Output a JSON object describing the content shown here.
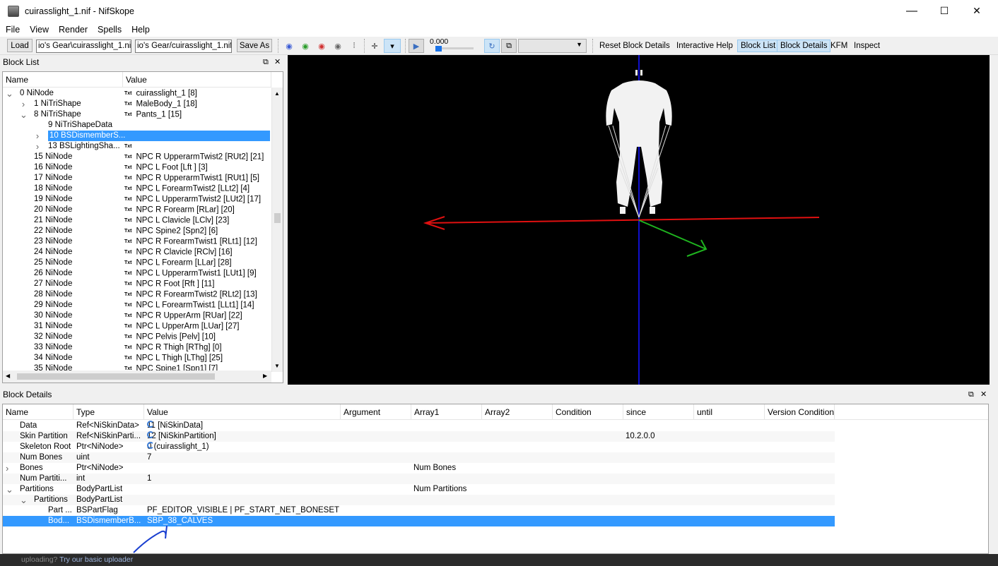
{
  "window": {
    "title": "cuirasslight_1.nif - NifSkope",
    "min": "—",
    "max": "☐",
    "close": "✕"
  },
  "menu": [
    "File",
    "View",
    "Render",
    "Spells",
    "Help"
  ],
  "toolbar": {
    "load": "Load",
    "load_path": "io's Gear\\cuirasslight_1.nif",
    "save_path": "io's Gear/cuirasslight_1.nif",
    "save_as": "Save As",
    "time_value": "0.000",
    "links": [
      "Reset Block Details",
      "Interactive Help",
      "Block List",
      "Block Details",
      "KFM",
      "Inspect"
    ],
    "active_links": [
      "Block List",
      "Block Details"
    ]
  },
  "block_list": {
    "title": "Block List",
    "col_name": "Name",
    "col_value": "Value",
    "txt_marker": "Txt",
    "rows": [
      {
        "name": "0 NiNode",
        "value": "cuirasslight_1 [8]",
        "depth": 0,
        "arrow": "expanded",
        "txt": true
      },
      {
        "name": "1 NiTriShape",
        "value": "MaleBody_1 [18]",
        "depth": 1,
        "arrow": "collapsed",
        "txt": true
      },
      {
        "name": "8 NiTriShape",
        "value": "Pants_1 [15]",
        "depth": 1,
        "arrow": "expanded",
        "txt": true
      },
      {
        "name": "9 NiTriShapeData",
        "value": "",
        "depth": 2,
        "arrow": "none",
        "txt": false
      },
      {
        "name": "10 BSDismemberS...",
        "value": "",
        "depth": 2,
        "arrow": "collapsed",
        "txt": false,
        "selected": true
      },
      {
        "name": "13 BSLightingSha...",
        "value": "",
        "depth": 2,
        "arrow": "collapsed",
        "txt": true
      },
      {
        "name": "15 NiNode",
        "value": "NPC R UpperarmTwist2 [RUt2] [21]",
        "depth": 1,
        "arrow": "none",
        "txt": true
      },
      {
        "name": "16 NiNode",
        "value": "NPC L Foot [Lft ] [3]",
        "depth": 1,
        "arrow": "none",
        "txt": true
      },
      {
        "name": "17 NiNode",
        "value": "NPC R UpperarmTwist1 [RUt1] [5]",
        "depth": 1,
        "arrow": "none",
        "txt": true
      },
      {
        "name": "18 NiNode",
        "value": "NPC L ForearmTwist2 [LLt2] [4]",
        "depth": 1,
        "arrow": "none",
        "txt": true
      },
      {
        "name": "19 NiNode",
        "value": "NPC L UpperarmTwist2 [LUt2] [17]",
        "depth": 1,
        "arrow": "none",
        "txt": true
      },
      {
        "name": "20 NiNode",
        "value": "NPC R Forearm [RLar] [20]",
        "depth": 1,
        "arrow": "none",
        "txt": true
      },
      {
        "name": "21 NiNode",
        "value": "NPC L Clavicle [LClv] [23]",
        "depth": 1,
        "arrow": "none",
        "txt": true
      },
      {
        "name": "22 NiNode",
        "value": "NPC Spine2 [Spn2] [6]",
        "depth": 1,
        "arrow": "none",
        "txt": true
      },
      {
        "name": "23 NiNode",
        "value": "NPC R ForearmTwist1 [RLt1] [12]",
        "depth": 1,
        "arrow": "none",
        "txt": true
      },
      {
        "name": "24 NiNode",
        "value": "NPC R Clavicle [RClv] [16]",
        "depth": 1,
        "arrow": "none",
        "txt": true
      },
      {
        "name": "25 NiNode",
        "value": "NPC L Forearm [LLar] [28]",
        "depth": 1,
        "arrow": "none",
        "txt": true
      },
      {
        "name": "26 NiNode",
        "value": "NPC L UpperarmTwist1 [LUt1] [9]",
        "depth": 1,
        "arrow": "none",
        "txt": true
      },
      {
        "name": "27 NiNode",
        "value": "NPC R Foot [Rft ] [11]",
        "depth": 1,
        "arrow": "none",
        "txt": true
      },
      {
        "name": "28 NiNode",
        "value": "NPC R ForearmTwist2 [RLt2] [13]",
        "depth": 1,
        "arrow": "none",
        "txt": true
      },
      {
        "name": "29 NiNode",
        "value": "NPC L ForearmTwist1 [LLt1] [14]",
        "depth": 1,
        "arrow": "none",
        "txt": true
      },
      {
        "name": "30 NiNode",
        "value": "NPC R UpperArm [RUar] [22]",
        "depth": 1,
        "arrow": "none",
        "txt": true
      },
      {
        "name": "31 NiNode",
        "value": "NPC L UpperArm [LUar] [27]",
        "depth": 1,
        "arrow": "none",
        "txt": true
      },
      {
        "name": "32 NiNode",
        "value": "NPC Pelvis [Pelv] [10]",
        "depth": 1,
        "arrow": "none",
        "txt": true
      },
      {
        "name": "33 NiNode",
        "value": "NPC R Thigh [RThg] [0]",
        "depth": 1,
        "arrow": "none",
        "txt": true
      },
      {
        "name": "34 NiNode",
        "value": "NPC L Thigh [LThg] [25]",
        "depth": 1,
        "arrow": "none",
        "txt": true
      },
      {
        "name": "35 NiNode",
        "value": "NPC Spine1 [Spn1] [7]",
        "depth": 1,
        "arrow": "none",
        "txt": true
      }
    ]
  },
  "block_details": {
    "title": "Block Details",
    "columns": [
      "Name",
      "Type",
      "Value",
      "Argument",
      "Array1",
      "Array2",
      "Condition",
      "since",
      "until",
      "Version Condition"
    ],
    "rows": [
      {
        "name": "Data",
        "type": "Ref<NiSkinData>",
        "value": "11 [NiSkinData]",
        "icon": "link-icon",
        "array1": "",
        "since": "",
        "depth": 0,
        "arrow": "none"
      },
      {
        "name": "Skin Partition",
        "type": "Ref<NiSkinParti...",
        "value": "12 [NiSkinPartition]",
        "icon": "link-icon",
        "array1": "",
        "since": "10.2.0.0",
        "depth": 0,
        "arrow": "none"
      },
      {
        "name": "Skeleton Root",
        "type": "Ptr<NiNode>",
        "value": "0 (cuirasslight_1)",
        "icon": "link-icon",
        "array1": "",
        "since": "",
        "depth": 0,
        "arrow": "none"
      },
      {
        "name": "Num Bones",
        "type": "uint",
        "value": "7",
        "icon": "",
        "array1": "",
        "since": "",
        "depth": 0,
        "arrow": "none"
      },
      {
        "name": "Bones",
        "type": "Ptr<NiNode>",
        "value": "",
        "icon": "footprints-icon",
        "array1": "Num Bones",
        "since": "",
        "depth": 0,
        "arrow": "collapsed"
      },
      {
        "name": "Num Partiti...",
        "type": "int",
        "value": "1",
        "icon": "",
        "array1": "",
        "since": "",
        "depth": 0,
        "arrow": "none"
      },
      {
        "name": "Partitions",
        "type": "BodyPartList",
        "value": "",
        "icon": "footprints-icon",
        "array1": "Num Partitions",
        "since": "",
        "depth": 0,
        "arrow": "expanded"
      },
      {
        "name": "Partitions",
        "type": "BodyPartList",
        "value": "",
        "icon": "",
        "array1": "",
        "since": "",
        "depth": 1,
        "arrow": "expanded"
      },
      {
        "name": "Part ...",
        "type": "BSPartFlag",
        "value": "PF_EDITOR_VISIBLE | PF_START_NET_BONESET",
        "icon": "",
        "array1": "",
        "since": "",
        "depth": 2,
        "arrow": "none"
      },
      {
        "name": "Bod...",
        "type": "BSDismemberB...",
        "value": "SBP_38_CALVES",
        "icon": "",
        "array1": "",
        "since": "",
        "depth": 2,
        "arrow": "none",
        "selected": true
      }
    ]
  },
  "status": {
    "text": "uploading? ",
    "link": "Try our basic uploader"
  },
  "colors": {
    "selection": "#3399ff",
    "x_axis": "#e01010",
    "y_axis": "#1fb41f",
    "z_axis": "#1010cc",
    "viewport_bg": "#000000"
  }
}
